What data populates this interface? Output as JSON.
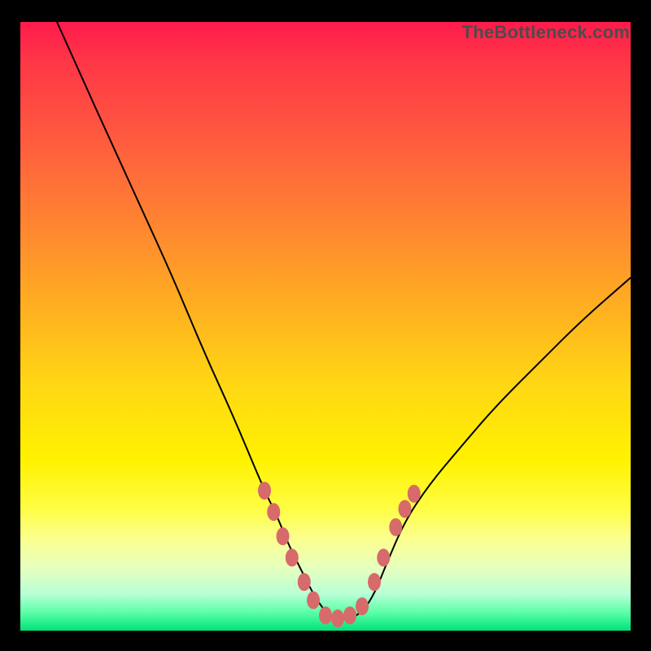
{
  "watermark": "TheBottleneck.com",
  "colors": {
    "curve_stroke": "#000000",
    "marker_fill": "#d76a6a",
    "background_frame": "#000000"
  },
  "chart_data": {
    "type": "line",
    "title": "",
    "xlabel": "",
    "ylabel": "",
    "xlim": [
      0,
      100
    ],
    "ylim": [
      0,
      100
    ],
    "series": [
      {
        "name": "bottleneck-curve",
        "x": [
          6,
          10,
          15,
          20,
          25,
          30,
          35,
          40,
          42,
          44,
          46,
          48,
          50,
          52,
          54,
          56,
          58,
          60,
          63,
          67,
          72,
          78,
          85,
          92,
          100
        ],
        "y": [
          100,
          91,
          80,
          69,
          58,
          46,
          35,
          23,
          19,
          14,
          10,
          6,
          3,
          2,
          2,
          3,
          6,
          11,
          18,
          24,
          30,
          37,
          44,
          51,
          58
        ]
      }
    ],
    "markers": [
      {
        "x": 40.0,
        "y": 23.0
      },
      {
        "x": 41.5,
        "y": 19.5
      },
      {
        "x": 43.0,
        "y": 15.5
      },
      {
        "x": 44.5,
        "y": 12.0
      },
      {
        "x": 46.5,
        "y": 8.0
      },
      {
        "x": 48.0,
        "y": 5.0
      },
      {
        "x": 50.0,
        "y": 2.5
      },
      {
        "x": 52.0,
        "y": 2.0
      },
      {
        "x": 54.0,
        "y": 2.5
      },
      {
        "x": 56.0,
        "y": 4.0
      },
      {
        "x": 58.0,
        "y": 8.0
      },
      {
        "x": 59.5,
        "y": 12.0
      },
      {
        "x": 61.5,
        "y": 17.0
      },
      {
        "x": 63.0,
        "y": 20.0
      },
      {
        "x": 64.5,
        "y": 22.5
      }
    ]
  }
}
